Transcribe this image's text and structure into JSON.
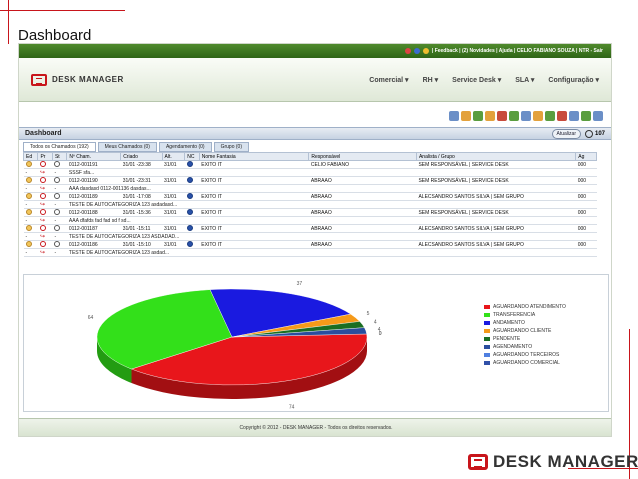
{
  "slide": {
    "title": "Dashboard",
    "brand": "DESK MANAGER"
  },
  "topbar": {
    "links": "| Feedback | (2) Novidades | Ajuda | CELIO FABIANO SOUZA | NTR - Sair"
  },
  "app": {
    "logo": "DESK MANAGER",
    "menu": [
      "Comercial ▾",
      "RH ▾",
      "Service Desk ▾",
      "SLA ▾",
      "Configuração ▾"
    ]
  },
  "dashboard": {
    "title": "Dashboard",
    "update_button": "Atualizar",
    "count": "107"
  },
  "tabs": [
    "Todos os Chamados (192)",
    "Meus Chamados (0)",
    "Agendamento (0)",
    "Grupo (0)"
  ],
  "table": {
    "headers": [
      "Ed",
      "Pr",
      "St",
      "Nº Cham.",
      "Criado",
      "Alt.",
      "NC",
      "Nome Fantasia",
      "Responsável",
      "Analista / Grupo",
      "Ag"
    ],
    "rows": [
      {
        "cham": "0112-001191",
        "criado": "31/01 -23:38",
        "alt": "31/01",
        "nome": "EXITO IT",
        "resp": "CELIO FABIANO",
        "analista": "SEM RESPONSÁVEL | SERVICE DESK",
        "ag": "000",
        "desc": "SSSF sfa..."
      },
      {
        "cham": "0112-001190",
        "criado": "31/01 -23:31",
        "alt": "31/01",
        "nome": "EXITO IT",
        "resp": "ABRAAO",
        "analista": "SEM RESPONSÁVEL | SERVICE DESK",
        "ag": "000",
        "desc": "AAA dasdasd 0112-001136 dasdas..."
      },
      {
        "cham": "0112-001189",
        "criado": "31/01 -17:08",
        "alt": "31/01",
        "nome": "EXITO IT",
        "resp": "ABRAAO",
        "analista": "ALECSANDRO SANTOS SILVA | SEM GRUPO",
        "ag": "000",
        "desc": "TESTE DE AUTOCATEGORIZA 123 asdadasd..."
      },
      {
        "cham": "0112-001188",
        "criado": "31/01 -15:36",
        "alt": "31/01",
        "nome": "EXITO IT",
        "resp": "ABRAAO",
        "analista": "SEM RESPONSÁVEL | SERVICE DESK",
        "ag": "000",
        "desc": "AAA dfafds fad fad sd f sd..."
      },
      {
        "cham": "0112-001187",
        "criado": "31/01 -15:11",
        "alt": "31/01",
        "nome": "EXITO IT",
        "resp": "ABRAAO",
        "analista": "ALECSANDRO SANTOS SILVA | SEM GRUPO",
        "ag": "000",
        "desc": "TESTE DE AUTOCATEGORIZA 123 ASDADAD..."
      },
      {
        "cham": "0112-001186",
        "criado": "31/01 -15:10",
        "alt": "31/01",
        "nome": "EXITO IT",
        "resp": "ABRAAO",
        "analista": "ALECSANDRO SANTOS SILVA | SEM GRUPO",
        "ag": "000",
        "desc": "TESTE DE AUTOCATEGORIZA 123 asdad..."
      }
    ]
  },
  "chart_data": {
    "type": "pie",
    "title": "",
    "categories": [
      "AGUARDANDO ATENDIMENTO",
      "TRANSFERENCIA",
      "ANDAMENTO",
      "AGUARDANDO CLIENTE",
      "PENDENTE",
      "AGENDAMENTO",
      "AGUARDANDO TERCEIROS",
      "AGUARDANDO COMERCIAL"
    ],
    "values": [
      74,
      64,
      37,
      5,
      4,
      4,
      0,
      0
    ],
    "colors": [
      "#e8161b",
      "#33e01a",
      "#1a1ae0",
      "#f59a1a",
      "#1a6e22",
      "#2a4e9e",
      "#4f7fe0",
      "#3050a8"
    ],
    "data_labels": [
      "74",
      "64",
      "37",
      "5",
      "4",
      "4",
      "0",
      "0"
    ],
    "legend_position": "right"
  },
  "footer": "Copyright © 2012 - DESK MANAGER - Todos os direitos reservados."
}
